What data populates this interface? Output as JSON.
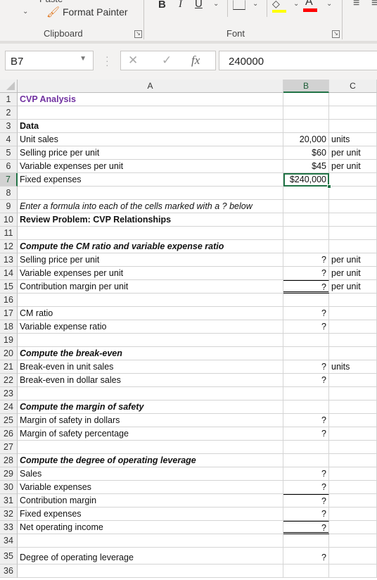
{
  "ribbon": {
    "paste_label": "Paste",
    "format_painter_label": "Format Painter",
    "clipboard_group": "Clipboard",
    "font_group": "Font",
    "bold": "B",
    "italic": "I",
    "underline": "U",
    "fill_color": "#ffff00",
    "font_color": "#ff0000",
    "font_color_letter": "A"
  },
  "formula_bar": {
    "name_box": "B7",
    "cancel": "✕",
    "enter": "✓",
    "fx": "fx",
    "formula": "240000"
  },
  "columns": [
    "A",
    "B",
    "C"
  ],
  "selected_cell": "B7",
  "rows": [
    {
      "n": "1",
      "a": "CVP Analysis",
      "b": "",
      "c": "",
      "style": "purple"
    },
    {
      "n": "2",
      "a": "",
      "b": "",
      "c": ""
    },
    {
      "n": "3",
      "a": "Data",
      "b": "",
      "c": "",
      "style": "bold"
    },
    {
      "n": "4",
      "a": "Unit sales",
      "b": "20,000",
      "c": "units"
    },
    {
      "n": "5",
      "a": "Selling price per unit",
      "b": "$60",
      "c": "per unit"
    },
    {
      "n": "6",
      "a": "Variable expenses per unit",
      "b": "$45",
      "c": "per unit"
    },
    {
      "n": "7",
      "a": "Fixed expenses",
      "b": "$240,000",
      "c": ""
    },
    {
      "n": "8",
      "a": "",
      "b": "",
      "c": ""
    },
    {
      "n": "9",
      "a": "Enter a formula into each of the cells marked with a ? below",
      "b": "",
      "c": "",
      "style": "ital"
    },
    {
      "n": "10",
      "a": "Review Problem: CVP Relationships",
      "b": "",
      "c": "",
      "style": "bold"
    },
    {
      "n": "11",
      "a": "",
      "b": "",
      "c": ""
    },
    {
      "n": "12",
      "a": "Compute the CM ratio and variable expense ratio",
      "b": "",
      "c": "",
      "style": "bold ital"
    },
    {
      "n": "13",
      "a": "Selling price per unit",
      "b": "?",
      "c": "per unit"
    },
    {
      "n": "14",
      "a": "Variable expenses per unit",
      "b": "?",
      "c": "per unit"
    },
    {
      "n": "15",
      "a": "Contribution margin per unit",
      "b": "?",
      "c": "per unit"
    },
    {
      "n": "16",
      "a": "",
      "b": "",
      "c": ""
    },
    {
      "n": "17",
      "a": "CM ratio",
      "b": "?",
      "c": ""
    },
    {
      "n": "18",
      "a": "Variable expense ratio",
      "b": "?",
      "c": ""
    },
    {
      "n": "19",
      "a": "",
      "b": "",
      "c": ""
    },
    {
      "n": "20",
      "a": "Compute the break-even",
      "b": "",
      "c": "",
      "style": "bold ital"
    },
    {
      "n": "21",
      "a": "Break-even in unit sales",
      "b": "?",
      "c": "units"
    },
    {
      "n": "22",
      "a": "Break-even in dollar sales",
      "b": "?",
      "c": ""
    },
    {
      "n": "23",
      "a": "",
      "b": "",
      "c": ""
    },
    {
      "n": "24",
      "a": "Compute the margin of safety",
      "b": "",
      "c": "",
      "style": "bold ital"
    },
    {
      "n": "25",
      "a": "Margin of safety in dollars",
      "b": "?",
      "c": ""
    },
    {
      "n": "26",
      "a": "Margin of safety percentage",
      "b": "?",
      "c": ""
    },
    {
      "n": "27",
      "a": "",
      "b": "",
      "c": ""
    },
    {
      "n": "28",
      "a": "Compute the degree of operating leverage",
      "b": "",
      "c": "",
      "style": "bold ital"
    },
    {
      "n": "29",
      "a": "Sales",
      "b": "?",
      "c": ""
    },
    {
      "n": "30",
      "a": "Variable expenses",
      "b": "?",
      "c": ""
    },
    {
      "n": "31",
      "a": "Contribution margin",
      "b": "?",
      "c": ""
    },
    {
      "n": "32",
      "a": "Fixed expenses",
      "b": "?",
      "c": ""
    },
    {
      "n": "33",
      "a": "Net operating income",
      "b": "?",
      "c": ""
    },
    {
      "n": "34",
      "a": "",
      "b": "",
      "c": ""
    },
    {
      "n": "35",
      "a": "Degree of operating leverage",
      "b": "?",
      "c": ""
    },
    {
      "n": "36",
      "a": "",
      "b": "",
      "c": ""
    }
  ]
}
